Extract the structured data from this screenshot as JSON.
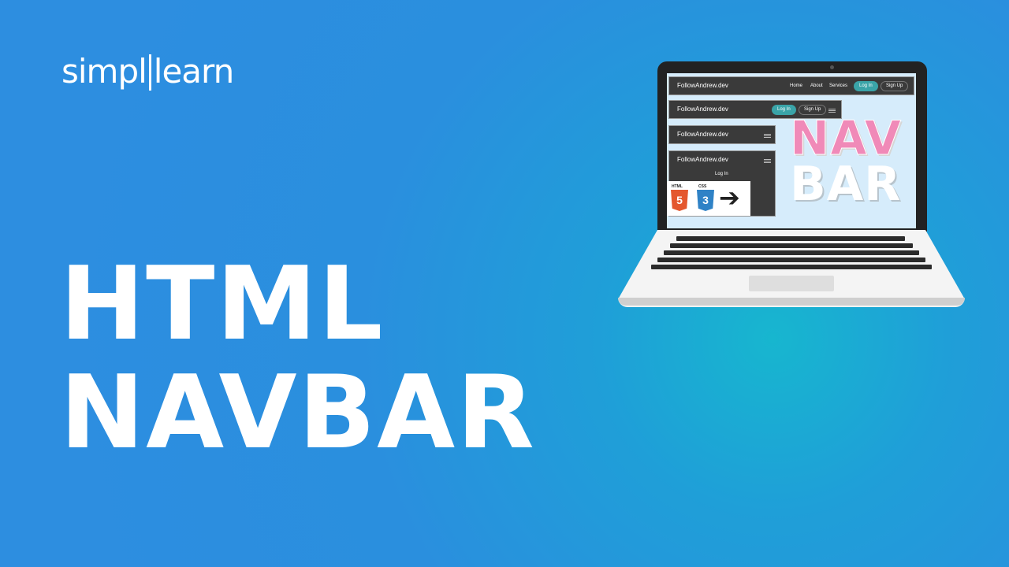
{
  "logo": {
    "part1": "simpl",
    "part2": "learn"
  },
  "headline": {
    "line1": "HTML",
    "line2": "NAVBAR"
  },
  "laptop_screen": {
    "nav_full": {
      "brand": "FollowAndrew.dev",
      "links": [
        "Home",
        "About",
        "Services"
      ],
      "login": "Log In",
      "signup": "Sign Up"
    },
    "nav_medium": {
      "brand": "FollowAndrew.dev",
      "login": "Log In",
      "signup": "Sign Up"
    },
    "nav_small": {
      "brand": "FollowAndrew.dev"
    },
    "nav_open": {
      "brand": "FollowAndrew.dev",
      "login": "Log In"
    },
    "big_text": {
      "line1": "NAV",
      "line2": "BAR"
    },
    "tech_badges": {
      "html": "HTML",
      "html_num": "5",
      "css": "CSS",
      "css_num": "3",
      "arrow": "➔"
    }
  },
  "colors": {
    "background": "#2d8ee0",
    "pink": "#f08ab8",
    "teal": "#3aa4a8"
  }
}
